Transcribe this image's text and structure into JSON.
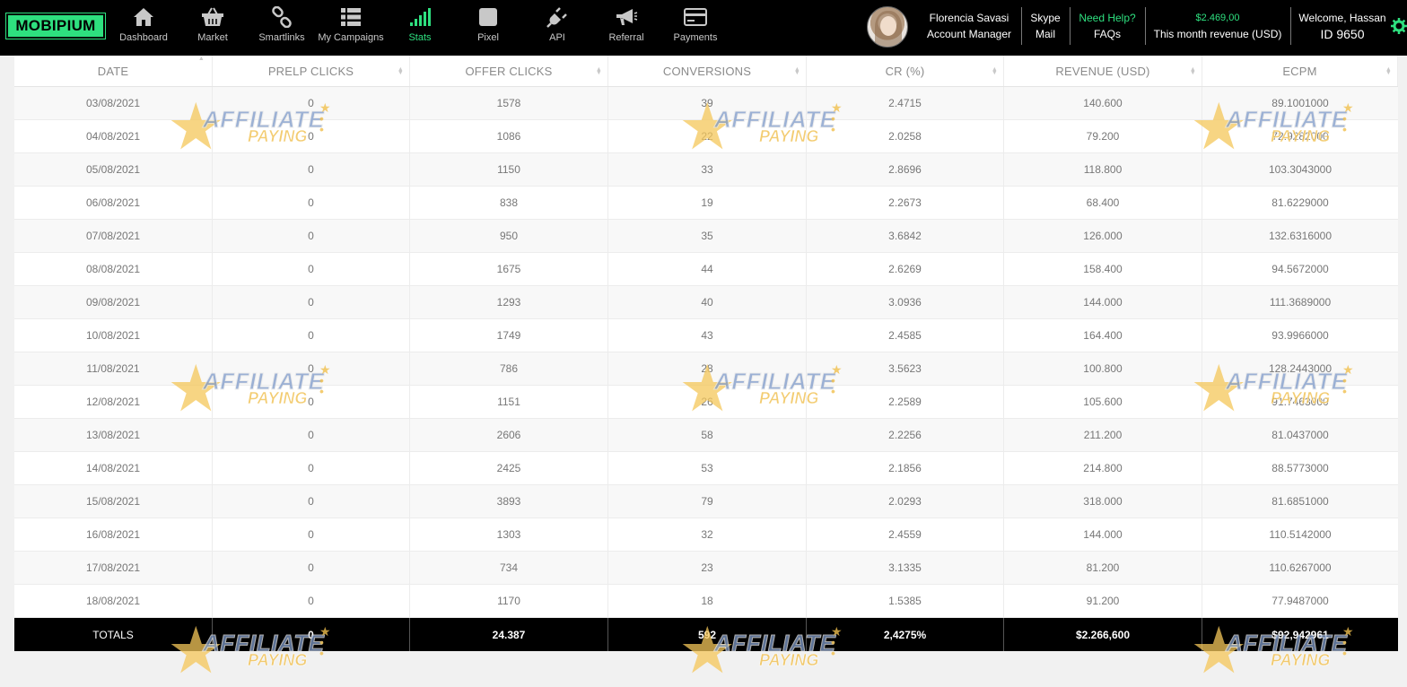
{
  "brand": {
    "logo_text": "MOBIPIUM"
  },
  "nav": [
    {
      "label": "Dashboard",
      "icon": "home-icon"
    },
    {
      "label": "Market",
      "icon": "basket-icon"
    },
    {
      "label": "Smartlinks",
      "icon": "link-icon"
    },
    {
      "label": "My Campaigns",
      "icon": "list-icon"
    },
    {
      "label": "Stats",
      "icon": "signal-bars-icon",
      "active": true
    },
    {
      "label": "Pixel",
      "icon": "pixel-square-icon"
    },
    {
      "label": "API",
      "icon": "plug-icon"
    },
    {
      "label": "Referral",
      "icon": "megaphone-icon"
    },
    {
      "label": "Payments",
      "icon": "credit-card-icon"
    }
  ],
  "manager": {
    "name": "Florencia Savasi",
    "role": "Account Manager"
  },
  "contact": {
    "skype": "Skype",
    "mail": "Mail"
  },
  "help": {
    "title": "Need Help?",
    "faqs": "FAQs"
  },
  "revenue": {
    "amount": "$2.469,00",
    "label": "This month revenue (USD)"
  },
  "user": {
    "welcome": "Welcome, Hassan",
    "id": "ID 9650"
  },
  "colors": {
    "accent": "#2ee07f",
    "header_bg": "#000000"
  },
  "watermark": {
    "line1": "AFFILIATE",
    "line2": "PAYING"
  },
  "table": {
    "columns": [
      "DATE",
      "PRELP CLICKS",
      "OFFER CLICKS",
      "CONVERSIONS",
      "CR (%)",
      "REVENUE (USD)",
      "ECPM"
    ],
    "rows": [
      [
        "03/08/2021",
        "0",
        "1578",
        "39",
        "2.4715",
        "140.600",
        "89.1001000"
      ],
      [
        "04/08/2021",
        "0",
        "1086",
        "22",
        "2.0258",
        "79.200",
        "72.9282000"
      ],
      [
        "05/08/2021",
        "0",
        "1150",
        "33",
        "2.8696",
        "118.800",
        "103.3043000"
      ],
      [
        "06/08/2021",
        "0",
        "838",
        "19",
        "2.2673",
        "68.400",
        "81.6229000"
      ],
      [
        "07/08/2021",
        "0",
        "950",
        "35",
        "3.6842",
        "126.000",
        "132.6316000"
      ],
      [
        "08/08/2021",
        "0",
        "1675",
        "44",
        "2.6269",
        "158.400",
        "94.5672000"
      ],
      [
        "09/08/2021",
        "0",
        "1293",
        "40",
        "3.0936",
        "144.000",
        "111.3689000"
      ],
      [
        "10/08/2021",
        "0",
        "1749",
        "43",
        "2.4585",
        "164.400",
        "93.9966000"
      ],
      [
        "11/08/2021",
        "0",
        "786",
        "28",
        "3.5623",
        "100.800",
        "128.2443000"
      ],
      [
        "12/08/2021",
        "0",
        "1151",
        "26",
        "2.2589",
        "105.600",
        "91.7463000"
      ],
      [
        "13/08/2021",
        "0",
        "2606",
        "58",
        "2.2256",
        "211.200",
        "81.0437000"
      ],
      [
        "14/08/2021",
        "0",
        "2425",
        "53",
        "2.1856",
        "214.800",
        "88.5773000"
      ],
      [
        "15/08/2021",
        "0",
        "3893",
        "79",
        "2.0293",
        "318.000",
        "81.6851000"
      ],
      [
        "16/08/2021",
        "0",
        "1303",
        "32",
        "2.4559",
        "144.000",
        "110.5142000"
      ],
      [
        "17/08/2021",
        "0",
        "734",
        "23",
        "3.1335",
        "81.200",
        "110.6267000"
      ],
      [
        "18/08/2021",
        "0",
        "1170",
        "18",
        "1.5385",
        "91.200",
        "77.9487000"
      ]
    ],
    "totals": [
      "TOTALS",
      "0",
      "24.387",
      "592",
      "2,4275%",
      "$2.266,600",
      "$92,942961"
    ]
  }
}
